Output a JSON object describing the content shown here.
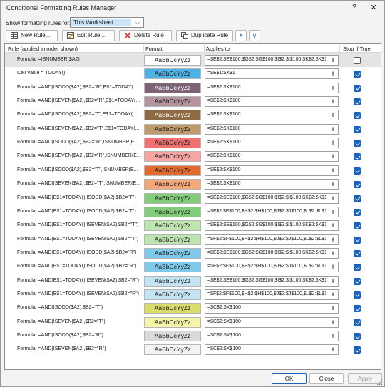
{
  "window": {
    "title": "Conditional Formatting Rules Manager",
    "help_label": "?",
    "close_label": "✕"
  },
  "scope": {
    "label": "Show formatting rules for:",
    "value": "This Worksheet",
    "arrow": "⌵"
  },
  "toolbar": {
    "new_rule": "New Rule...",
    "edit_rule": "Edit Rule...",
    "delete_rule": "Delete Rule",
    "duplicate_rule": "Duplicate Rule",
    "move_up": "∧",
    "move_down": "∨"
  },
  "columns": {
    "rule": "Rule (applied in order shown)",
    "format": "Format",
    "applies_to": "Applies to",
    "stop_if_true": "Stop If True"
  },
  "preview_text": "AaBbCcYyZz",
  "rules": [
    {
      "rule": "Formula: =ISNUMBER($A2)",
      "fill": "#ffffff",
      "color": "#1a1a1a",
      "applies": "=$E$2:$E$100,$G$2:$G$100,$I$2:$I$100,$K$2:$K$10",
      "stop": false,
      "selected": true
    },
    {
      "rule": "Cell Value = TODAY()",
      "fill": "#4db3e6",
      "color": "#1a1a1a",
      "applies": "=$E$1:$X$1",
      "stop": true
    },
    {
      "rule": "Formula: =AND(ISODD($A2),$B2=\"R\",E$1=TODAY(...",
      "fill": "#7d6475",
      "color": "#ffffff",
      "applies": "=$E$2:$X$100",
      "stop": true
    },
    {
      "rule": "Formula: =AND(ISEVEN($A2),$B2=\"R\",E$1=TODAY(...",
      "fill": "#b4939c",
      "color": "#1a1a1a",
      "applies": "=$E$2:$X$100",
      "stop": true
    },
    {
      "rule": "Formula: =AND(ISODD($A2),$B2=\"T\",E$1=TODAY(...",
      "fill": "#8b6a44",
      "color": "#ffffff",
      "applies": "=$E$2:$X$100",
      "stop": true
    },
    {
      "rule": "Formula: =AND(ISEVEN($A2),$B2=\"T\",E$1=TODAY(...",
      "fill": "#be9a6c",
      "color": "#1a1a1a",
      "applies": "=$E$2:$X$100",
      "stop": true
    },
    {
      "rule": "Formula: =AND(ISODD($A2),$B2=\"R\",ISNUMBER(E...",
      "fill": "#f07070",
      "color": "#1a1a1a",
      "applies": "=$E$2:$X$100",
      "stop": true
    },
    {
      "rule": "Formula: =AND(ISEVEN($A2),$B2=\"R\",ISNUMBER(E...",
      "fill": "#f5a6a2",
      "color": "#1a1a1a",
      "applies": "=$E$2:$X$100",
      "stop": true
    },
    {
      "rule": "Formula: =AND(ISODD($A2),$B2=\"T\",ISNUMBER(E...",
      "fill": "#e26a2c",
      "color": "#1a1a1a",
      "applies": "=$E$2:$X$100",
      "stop": true
    },
    {
      "rule": "Formula: =AND(ISEVEN($A2),$B2=\"T\",ISNUMBER(E...",
      "fill": "#f5a877",
      "color": "#1a1a1a",
      "applies": "=$E$2:$X$100",
      "stop": true
    },
    {
      "rule": "Formula: =AND(E$1=TODAY(),ISODD($A2),$B2=\"T\")",
      "fill": "#82cc7a",
      "color": "#1a1a1a",
      "applies": "=$E$2:$E$100,$G$2:$G$100,$I$2:$I$100,$K$2:$K$10",
      "stop": true
    },
    {
      "rule": "Formula: =AND(E$1=TODAY(),ISODD($A2),$B2=\"T\")",
      "fill": "#82cc7a",
      "color": "#1a1a1a",
      "applies": "=$F$2:$F$100,$H$2:$H$100,$J$2:$J$100,$L$2:$L$10",
      "stop": true
    },
    {
      "rule": "Formula: =AND(E$1=TODAY(),ISEVEN($A2),$B2=\"T\")",
      "fill": "#bde5b0",
      "color": "#1a1a1a",
      "applies": "=$E$2:$E$100,$G$2:$G$100,$I$2:$I$100,$K$2:$K$10",
      "stop": true
    },
    {
      "rule": "Formula: =AND(E$1=TODAY(),ISEVEN($A2),$B2=\"T\")",
      "fill": "#bde5b0",
      "color": "#1a1a1a",
      "applies": "=$F$2:$F$100,$H$2:$H$100,$J$2:$J$100,$L$2:$L$10",
      "stop": true
    },
    {
      "rule": "Formula: =AND(E$1=TODAY(),ISODD($A2),$B2=\"R\")",
      "fill": "#7fcaea",
      "color": "#1a1a1a",
      "applies": "=$E$2:$E$100,$G$2:$G$100,$I$2:$I$100,$K$2:$K$10",
      "stop": true
    },
    {
      "rule": "Formula: =AND(E$1=TODAY(),ISODD($A2),$B2=\"R\")",
      "fill": "#7fcaea",
      "color": "#1a1a1a",
      "applies": "=$F$2:$F$100,$H$2:$H$100,$J$2:$J$100,$L$2:$L$10",
      "stop": true
    },
    {
      "rule": "Formula: =AND(E$1=TODAY(),ISEVEN($A2),$B2=\"R\")",
      "fill": "#c4e4f3",
      "color": "#1a1a1a",
      "applies": "=$E$2:$E$100,$G$2:$G$100,$I$2:$I$100,$K$2:$K$10",
      "stop": true
    },
    {
      "rule": "Formula: =AND(E$1=TODAY(),ISEVEN($A2),$B2=\"R\")",
      "fill": "#c4e4f3",
      "color": "#1a1a1a",
      "applies": "=$F$2:$F$100,$H$2:$H$100,$J$2:$J$100,$L$2:$L$10",
      "stop": true
    },
    {
      "rule": "Formula: =AND(ISODD($A2),$B2=\"T\")",
      "fill": "#d9dc6a",
      "color": "#1a1a1a",
      "applies": "=$C$2:$X$100",
      "stop": true
    },
    {
      "rule": "Formula: =AND(ISEVEN($A2),$B2=\"T\")",
      "fill": "#f6f5a5",
      "color": "#1a1a1a",
      "applies": "=$C$2:$X$100",
      "stop": true
    },
    {
      "rule": "Formula: =AND(ISODD($A2),$B2=\"R\")",
      "fill": "#d9d9d9",
      "color": "#1a1a1a",
      "applies": "=$C$2:$X$100",
      "stop": true
    },
    {
      "rule": "Formula: =AND(ISEVEN($A2),$B2=\"R\")",
      "fill": "#f4f4f4",
      "color": "#1a1a1a",
      "applies": "=$C$2:$X$100",
      "stop": true
    }
  ],
  "footer": {
    "ok": "OK",
    "close": "Close",
    "apply": "Apply"
  }
}
